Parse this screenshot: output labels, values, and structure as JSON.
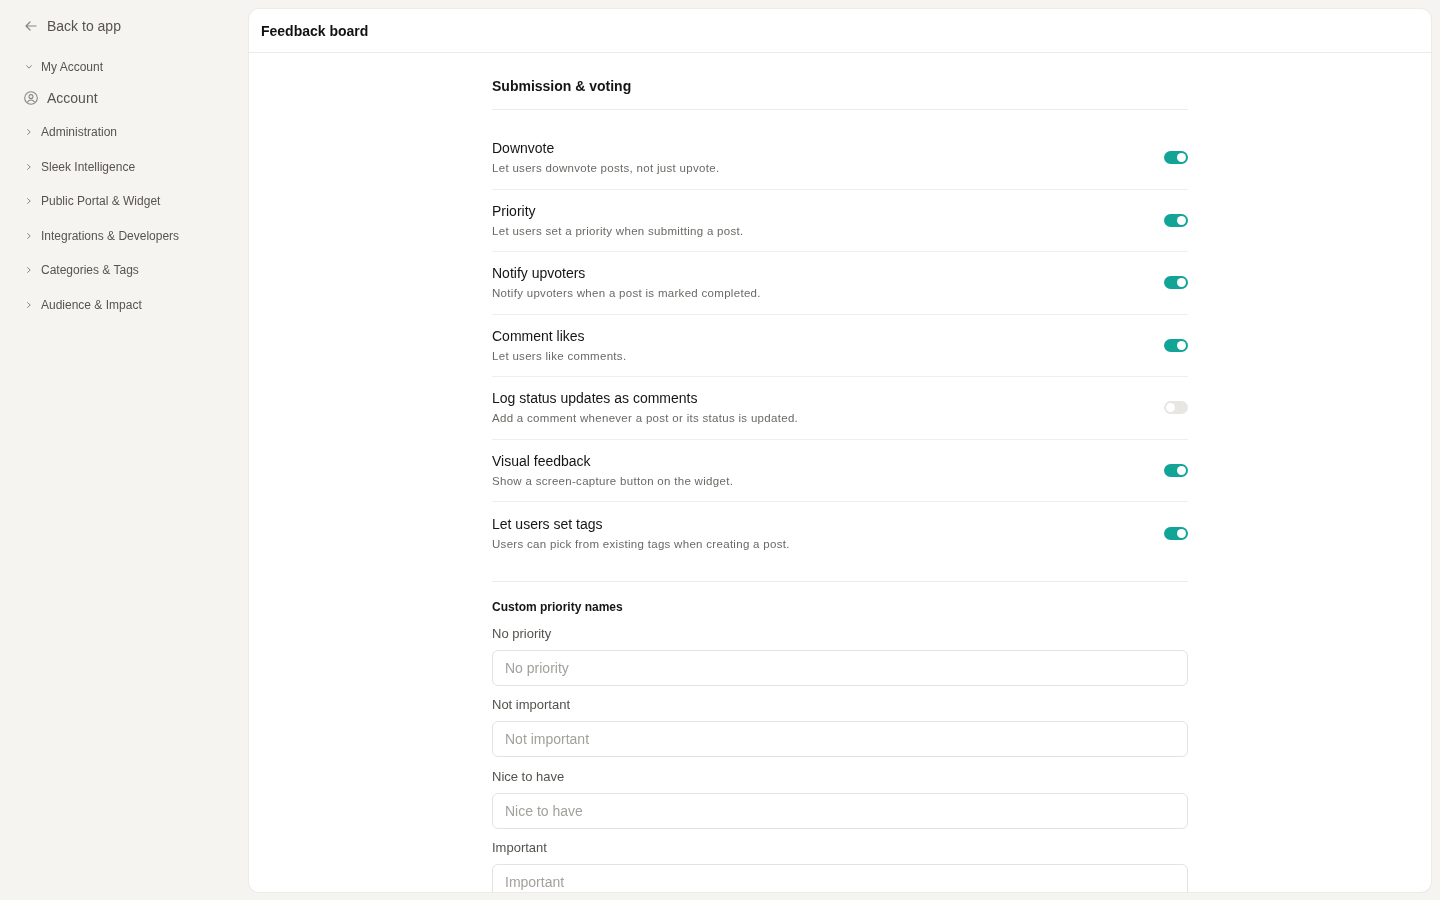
{
  "sidebar": {
    "back_link": "Back to app",
    "groups": [
      {
        "label": "My Account",
        "expanded": true,
        "children": [
          {
            "label": "Account"
          }
        ]
      },
      {
        "label": "Administration",
        "expanded": false
      },
      {
        "label": "Sleek Intelligence",
        "expanded": false
      },
      {
        "label": "Public Portal & Widget",
        "expanded": false
      },
      {
        "label": "Integrations & Developers",
        "expanded": false
      },
      {
        "label": "Categories & Tags",
        "expanded": false
      },
      {
        "label": "Audience & Impact",
        "expanded": false
      }
    ]
  },
  "page": {
    "title": "Feedback board"
  },
  "section": {
    "title": "Submission & voting",
    "settings": [
      {
        "title": "Downvote",
        "description": "Let users downvote posts, not just upvote.",
        "on": true
      },
      {
        "title": "Priority",
        "description": "Let users set a priority when submitting a post.",
        "on": true
      },
      {
        "title": "Notify upvoters",
        "description": "Notify upvoters when a post is marked completed.",
        "on": true
      },
      {
        "title": "Comment likes",
        "description": "Let users like comments.",
        "on": true
      },
      {
        "title": "Log status updates as comments",
        "description": "Add a comment whenever a post or its status is updated.",
        "on": false
      },
      {
        "title": "Visual feedback",
        "description": "Show a screen-capture button on the widget.",
        "on": true
      },
      {
        "title": "Let users set tags",
        "description": "Users can pick from existing tags when creating a post.",
        "on": true
      }
    ]
  },
  "priority_names": {
    "title": "Custom priority names",
    "fields": [
      {
        "label": "No priority",
        "placeholder": "No priority"
      },
      {
        "label": "Not important",
        "placeholder": "Not important"
      },
      {
        "label": "Nice to have",
        "placeholder": "Nice to have"
      },
      {
        "label": "Important",
        "placeholder": "Important"
      }
    ]
  }
}
